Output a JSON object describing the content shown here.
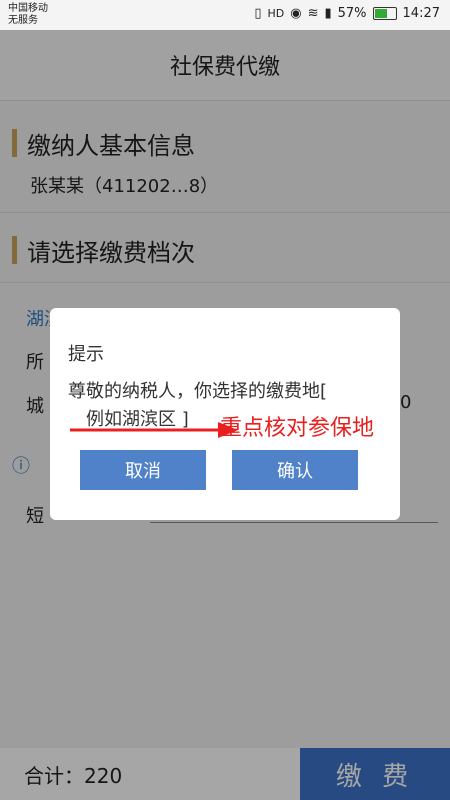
{
  "status": {
    "carrier_line1": "中国移动",
    "carrier_line2": "无服务",
    "battery": "57%",
    "time": "14:27",
    "hd": "HD"
  },
  "header": {
    "title": "社保费代缴"
  },
  "taxpayer": {
    "section_title": "缴纳人基本信息",
    "name_id": "张某某（411202…8）"
  },
  "grade": {
    "section_title": "请选择缴费档次",
    "item1": "湖滨区 41120…",
    "label2": "所",
    "label3": "城",
    "value3": "0",
    "label4": "短"
  },
  "dialog": {
    "title": "提示",
    "message_line1": "尊敬的纳税人，你选择的缴费地[",
    "message_line2": "例如湖滨区",
    "message_tail": "]",
    "cancel": "取消",
    "confirm": "确认"
  },
  "annotation": {
    "text": "重点核对参保地",
    "color": "#e82020"
  },
  "footer": {
    "total": "合计：220",
    "pay": "缴 费"
  }
}
